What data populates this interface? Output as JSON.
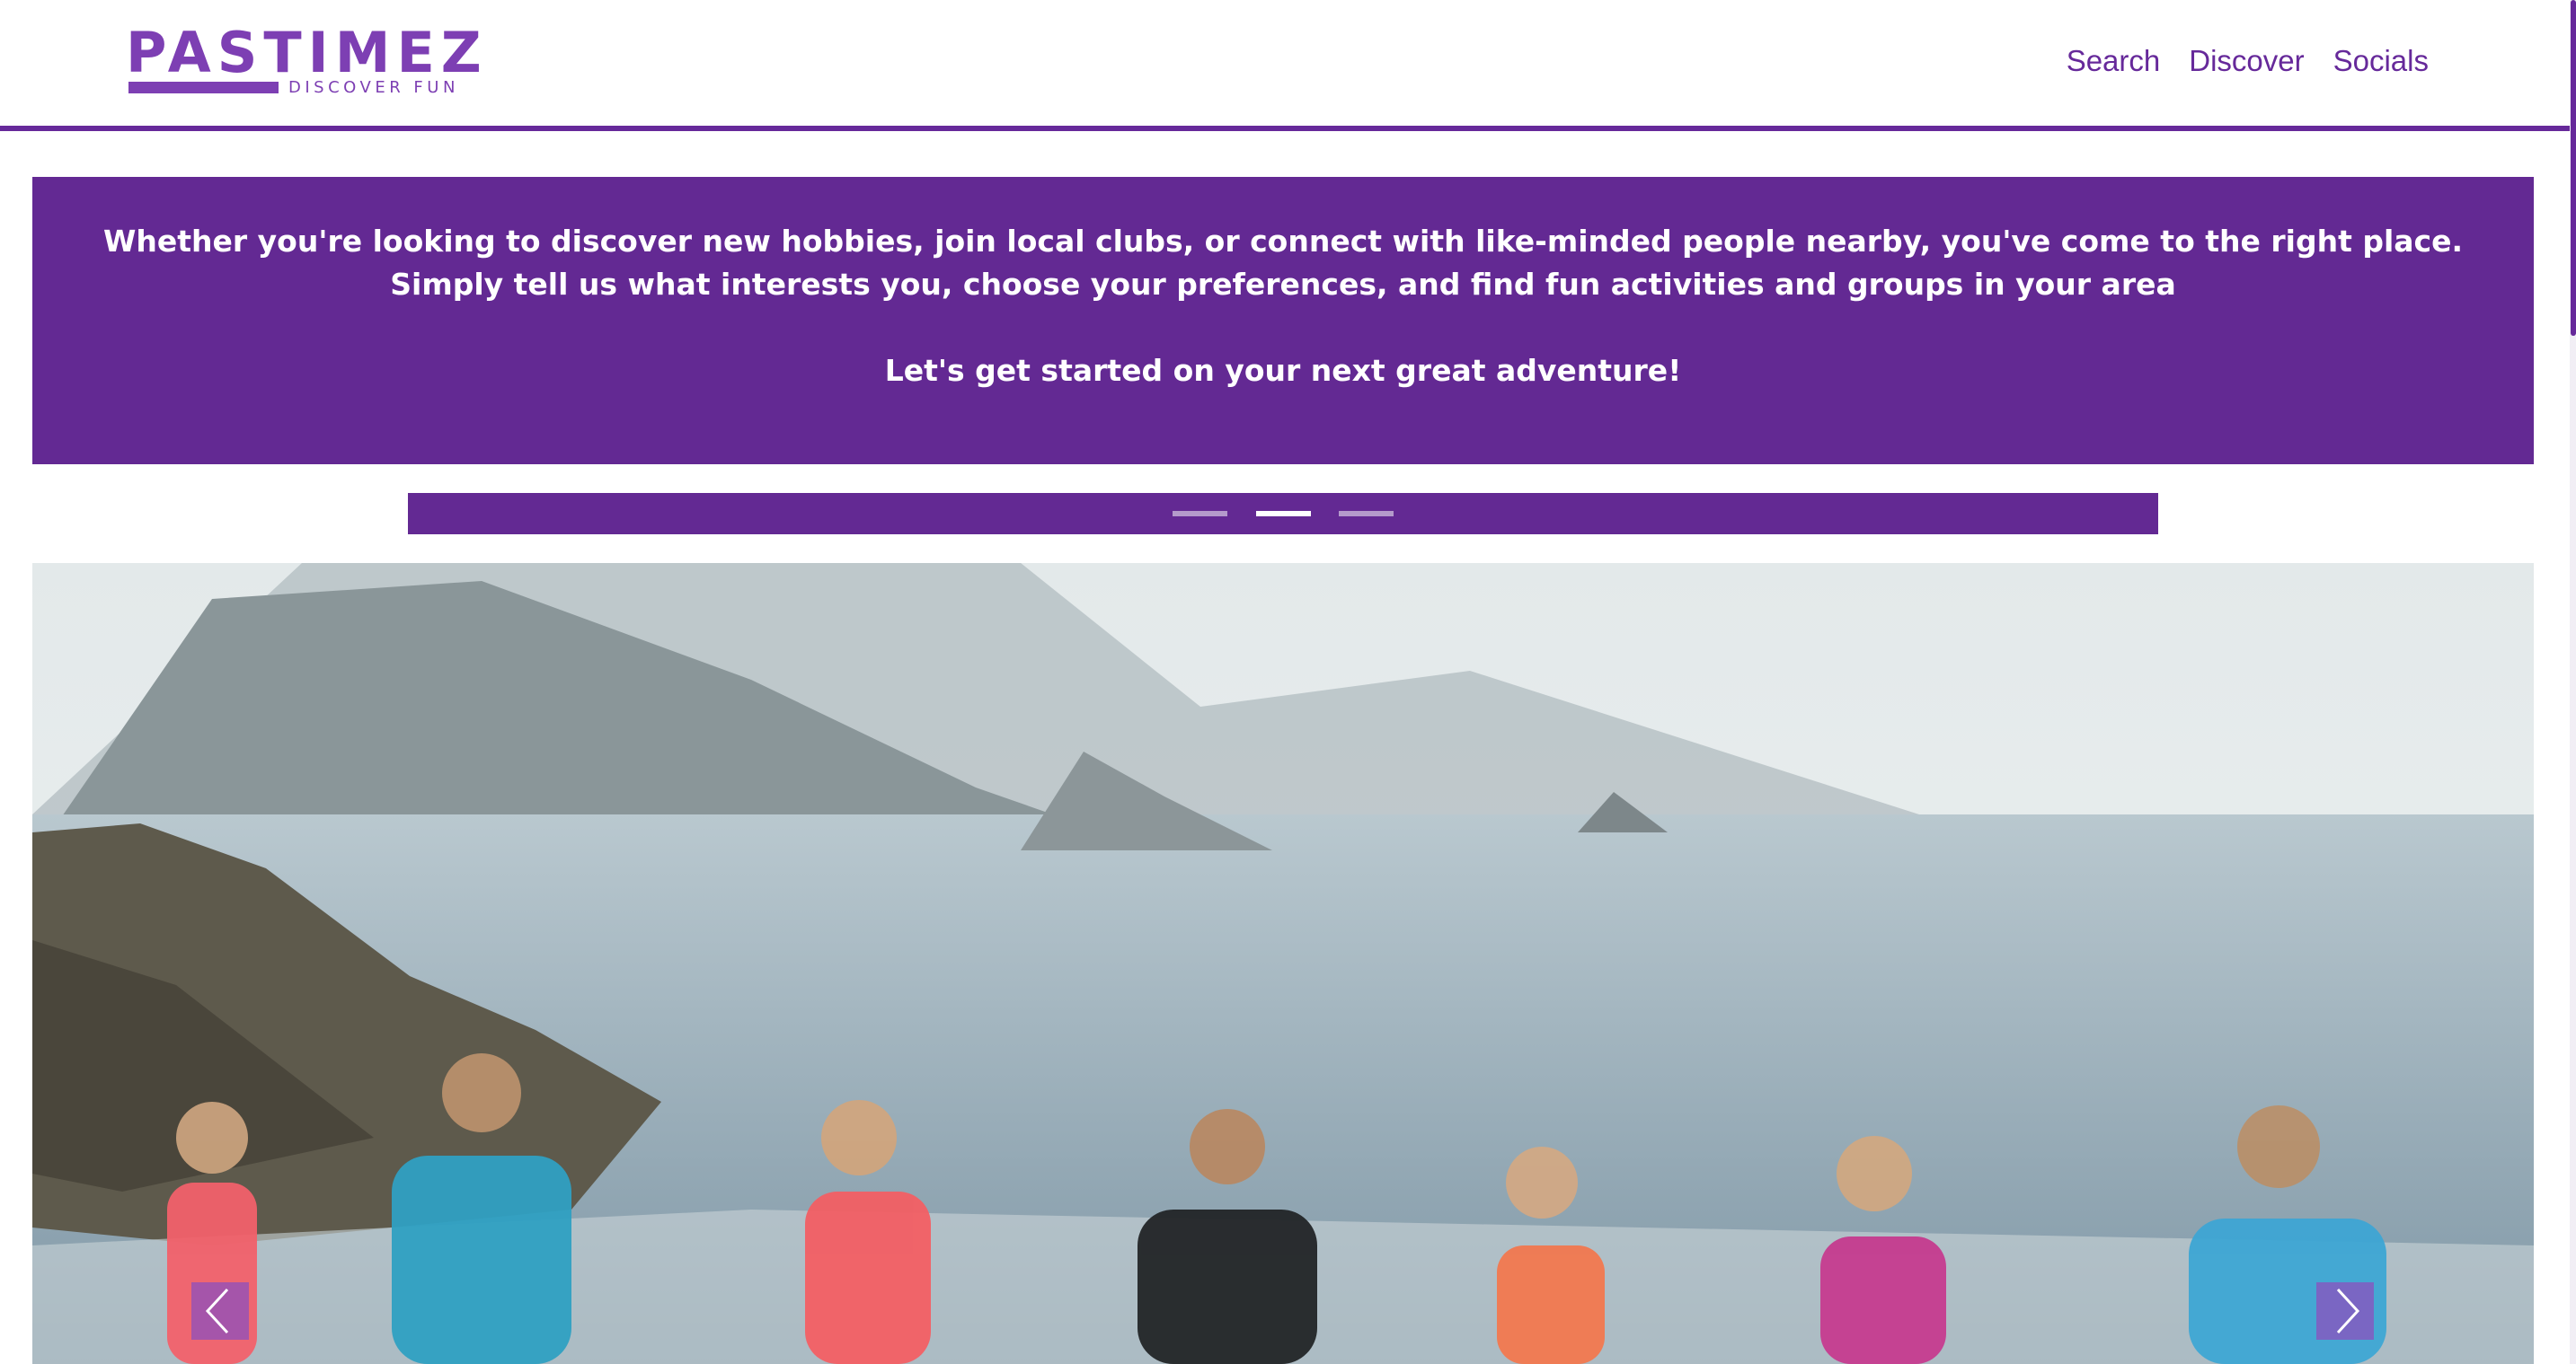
{
  "header": {
    "logo": {
      "word": "PASTIMEZ",
      "tagline": "DISCOVER FUN"
    },
    "nav": [
      {
        "label": "Search"
      },
      {
        "label": "Discover"
      },
      {
        "label": "Socials"
      }
    ]
  },
  "intro": {
    "line1": "Whether you're looking to discover new hobbies, join local clubs, or connect with like-minded people nearby, you've come to the right place.",
    "line2": "Simply tell us what interests you, choose your preferences, and find fun activities and groups in your area",
    "line3": "Let's get started on your next great adventure!"
  },
  "carousel": {
    "slide_count": 3,
    "active_slide": 2,
    "prev_icon": "chevron-left-icon",
    "next_icon": "chevron-right-icon"
  },
  "colors": {
    "brand": "#632993",
    "logo": "#7d3fb3",
    "indicator_inactive": "#b49acb",
    "indicator_active": "#ffffff"
  }
}
